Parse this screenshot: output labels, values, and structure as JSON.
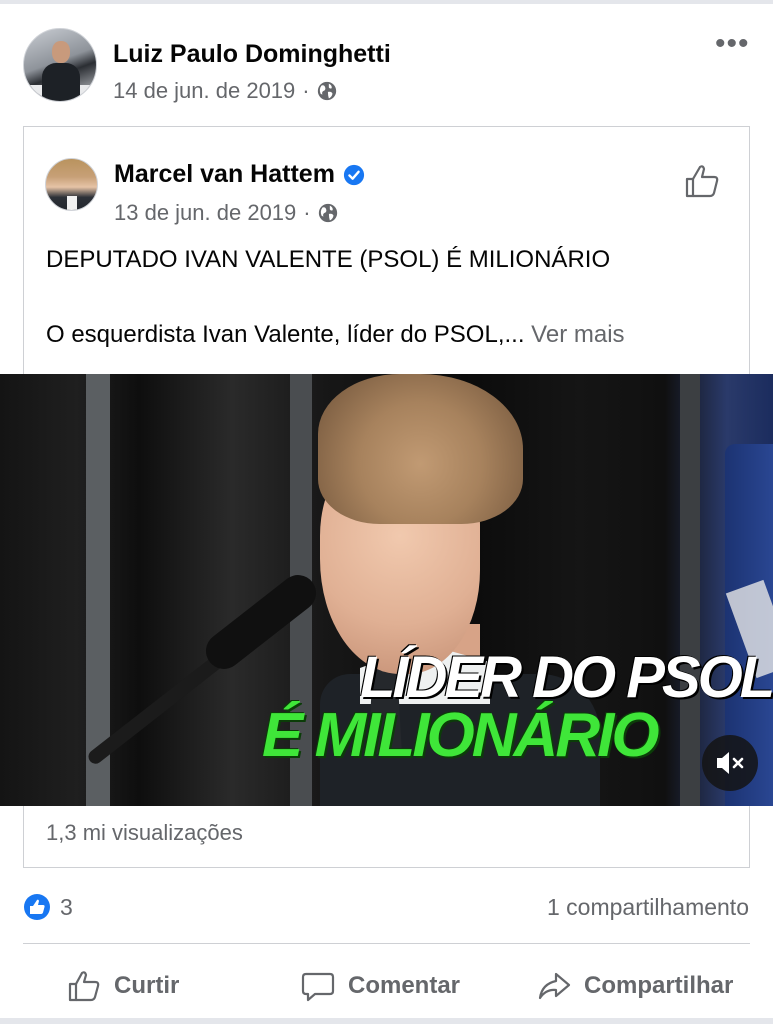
{
  "post": {
    "author_name": "Luiz Paulo Dominghetti",
    "date": "14 de jun. de 2019",
    "separator": "·",
    "more_icon": "more-icon",
    "more_glyph": "•••"
  },
  "shared_post": {
    "author_name": "Marcel van Hattem",
    "verified": true,
    "date": "13 de jun. de 2019",
    "separator": "·",
    "headline": "DEPUTADO IVAN VALENTE (PSOL) É MILIONÁRIO",
    "body_preview": "O esquerdista Ivan Valente, líder do PSOL,...",
    "see_more": " Ver mais",
    "video": {
      "caption_line1": "LÍDER DO PSOL",
      "caption_line2": "É MILIONÁRIO",
      "muted": true
    },
    "views": "1,3 mi visualizações"
  },
  "reactions": {
    "like_count": "3",
    "shares": "1 compartilhamento"
  },
  "actions": {
    "like_label": "Curtir",
    "comment_label": "Comentar",
    "share_label": "Compartilhar"
  },
  "colors": {
    "facebook_blue": "#1877f2",
    "secondary_text": "#65676b",
    "caption_green": "#3fe639"
  }
}
